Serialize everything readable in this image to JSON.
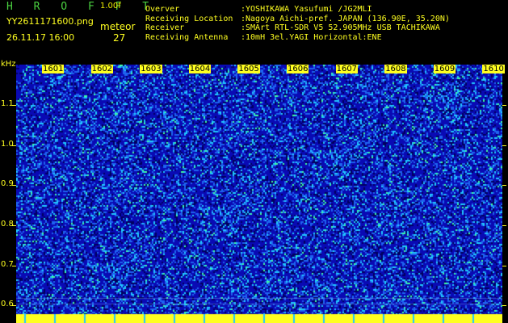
{
  "header": {
    "app_title": "H R O F F T",
    "version": "1.00f",
    "filename": "YY2611171600.png",
    "date_time": "26.11.17 16:00",
    "meteor_label": "meteor",
    "meteor_count": "27"
  },
  "station": {
    "observer_label": "Overver",
    "observer_value": ":YOSHIKAWA Yasufumi /JG2MLI",
    "location_label": "Receiving Location",
    "location_value": ":Nagoya Aichi-pref. JAPAN (136.90E, 35.20N)",
    "receiver_label": "Receiver",
    "receiver_value": ":SMArt RTL-SDR V5 52.905MHz USB TACHIKAWA",
    "antenna_label": "Receiving Antenna",
    "antenna_value": ":10mH 3el.YAGI Horizontal:ENE"
  },
  "axis": {
    "unit": "kHz",
    "y_labels": [
      "1.1",
      "1.0",
      "0.9",
      "0.8",
      "0.7",
      "0.6"
    ],
    "minutes": [
      "1601",
      "1602",
      "1603",
      "1604",
      "1605",
      "1606",
      "1607",
      "1608",
      "1609",
      "1610"
    ]
  },
  "colors": {
    "background": "#000000",
    "noise_dark": "#0a0ab4",
    "noise_mid": "#1e64f0",
    "noise_light": "#20c8ff",
    "highlight": "#40ffa0",
    "label": "#ffff20",
    "title": "#4ad040"
  }
}
